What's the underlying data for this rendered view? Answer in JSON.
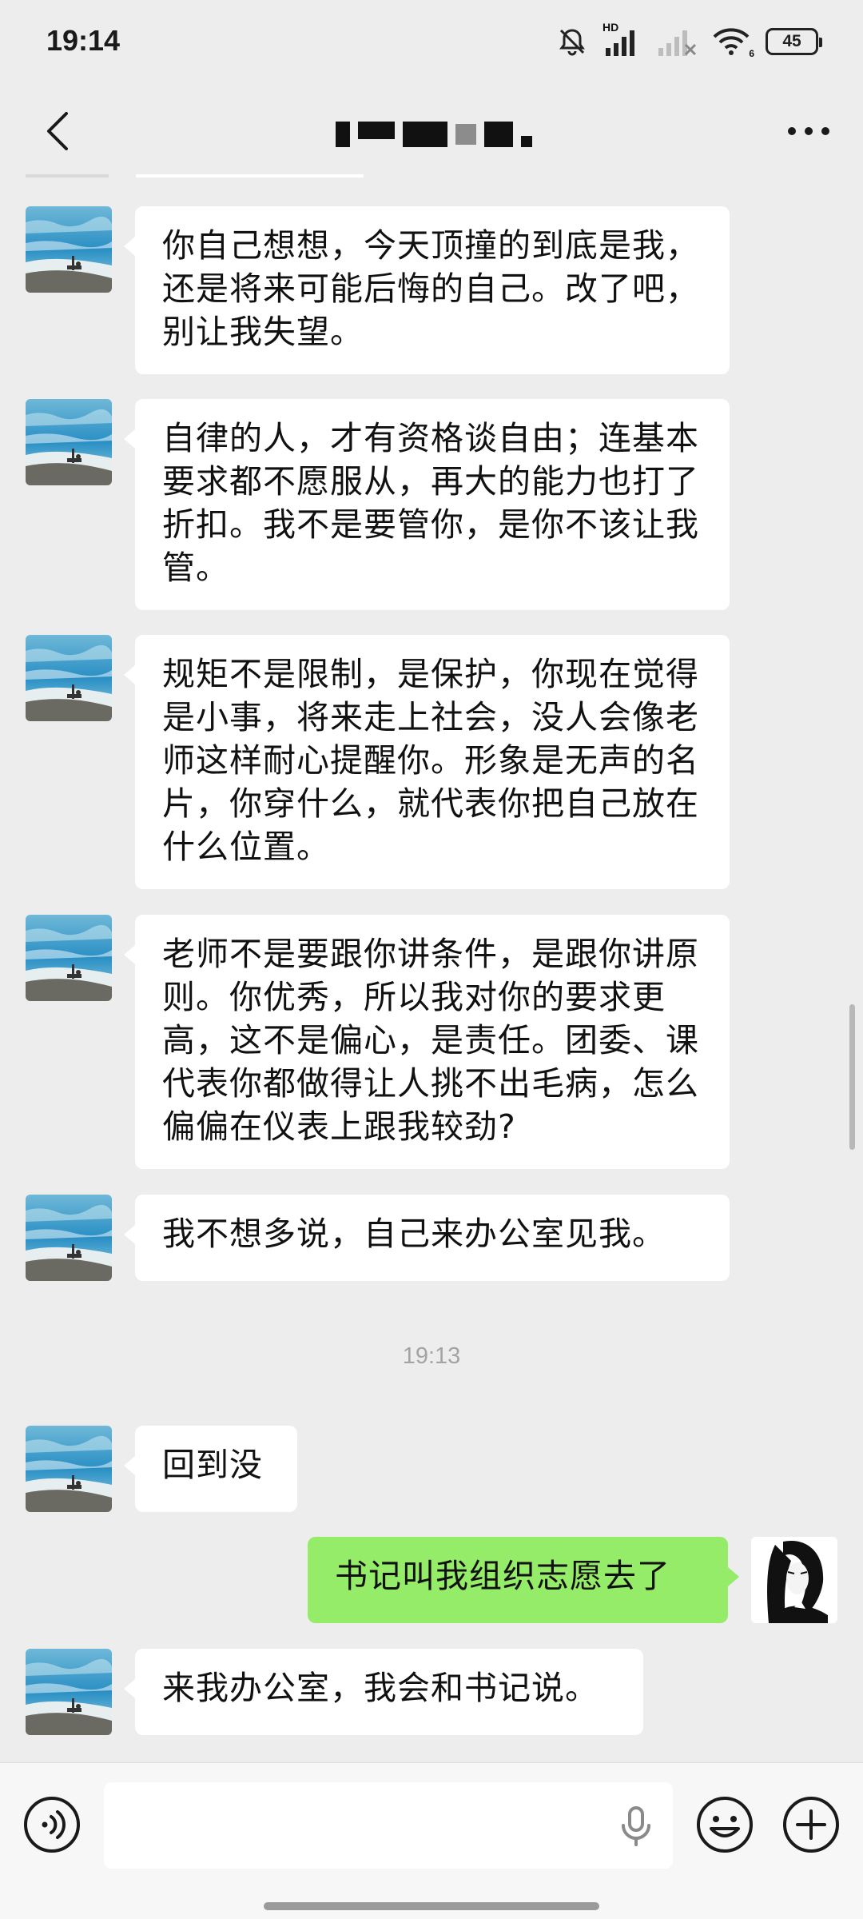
{
  "status_bar": {
    "time": "19:14",
    "signal_label": "HD",
    "wifi_label": "6",
    "battery": "45"
  },
  "header": {
    "title": "",
    "title_redacted": true
  },
  "messages": [
    {
      "side": "in",
      "text": "你自己想想，今天顶撞的到底是我，还是将来可能后悔的自己。改了吧，别让我失望。"
    },
    {
      "side": "in",
      "text": "自律的人，才有资格谈自由；连基本要求都不愿服从，再大的能力也打了折扣。我不是要管你，是你不该让我管。"
    },
    {
      "side": "in",
      "text": "规矩不是限制，是保护，你现在觉得是小事，将来走上社会，没人会像老师这样耐心提醒你。形象是无声的名片，你穿什么，就代表你把自己放在什么位置。"
    },
    {
      "side": "in",
      "text": "老师不是要跟你讲条件，是跟你讲原则。你优秀，所以我对你的要求更高，这不是偏心，是责任。团委、课代表你都做得让人挑不出毛病，怎么偏偏在仪表上跟我较劲?"
    },
    {
      "side": "in",
      "text": "我不想多说，自己来办公室见我。"
    },
    {
      "side": "in",
      "text": "回到没"
    },
    {
      "side": "out",
      "text": "书记叫我组织志愿去了"
    },
    {
      "side": "in",
      "text": "来我办公室，我会和书记说。"
    }
  ],
  "timestamp": "19:13",
  "input": {
    "value": "",
    "placeholder": ""
  },
  "icons": {
    "back": "chevron-left-icon",
    "more": "more-dots-icon",
    "voice": "voice-icon",
    "mic": "mic-icon",
    "emoji": "emoji-icon",
    "plus": "plus-icon",
    "mute": "bell-off-icon"
  },
  "colors": {
    "background": "#ededed",
    "incoming_bubble": "#ffffff",
    "outgoing_bubble": "#95ec69",
    "timestamp": "#a4a4a4"
  }
}
